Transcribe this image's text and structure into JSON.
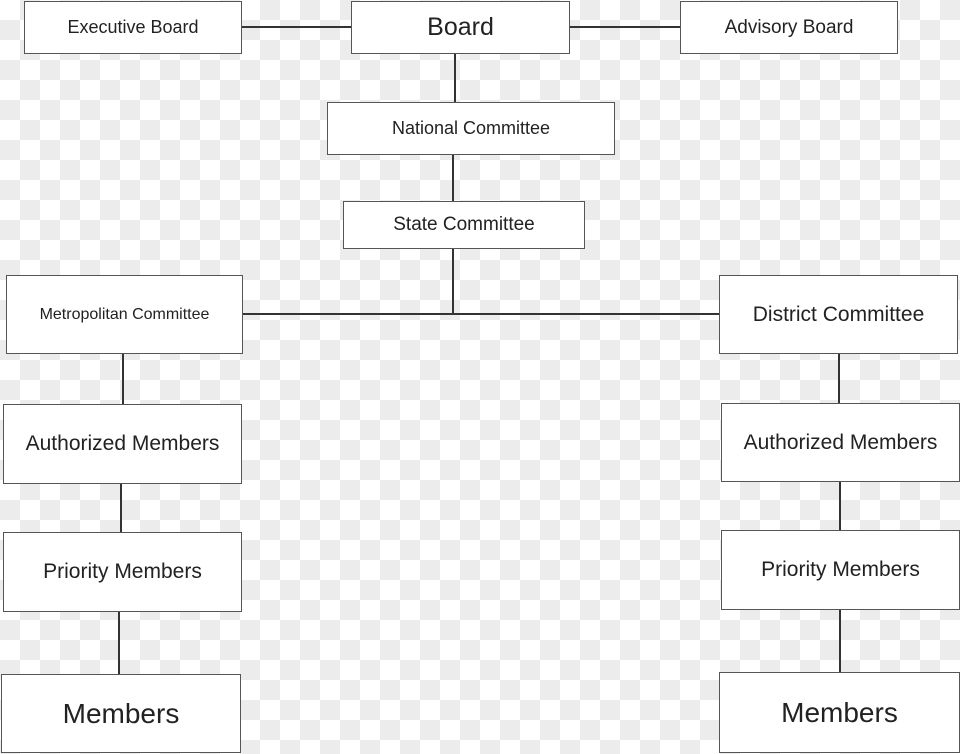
{
  "nodes": {
    "executive_board": "Executive Board",
    "board": "Board",
    "advisory_board": "Advisory Board",
    "national_committee": "National Committee",
    "state_committee": "State Committee",
    "metropolitan_committee": "Metropolitan Committee",
    "district_committee": "District Committee",
    "left_authorized": "Authorized Members",
    "left_priority": "Priority Members",
    "left_members": "Members",
    "right_authorized": "Authorized Members",
    "right_priority": "Priority Members",
    "right_members": "Members"
  }
}
